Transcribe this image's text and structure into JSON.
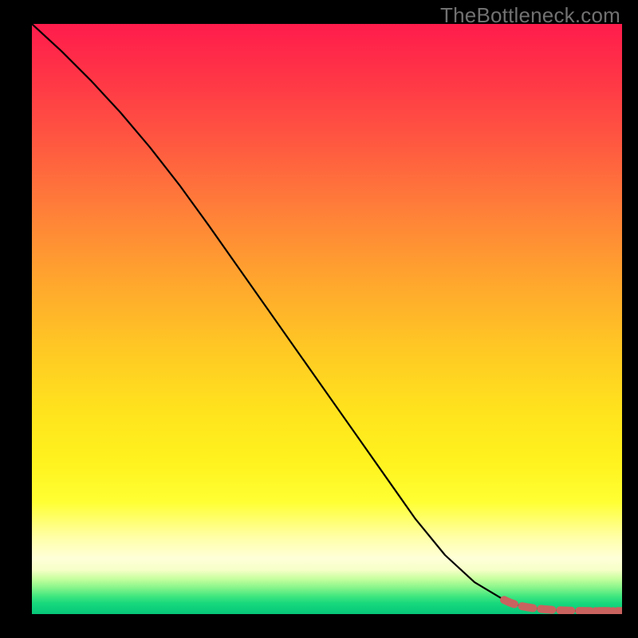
{
  "watermark": "TheBottleneck.com",
  "plot": {
    "x_min": 0,
    "x_max": 100,
    "y_min": 0,
    "y_max": 100
  },
  "chart_data": {
    "type": "line",
    "title": "",
    "xlabel": "",
    "ylabel": "",
    "xlim": [
      0,
      100
    ],
    "ylim": [
      0,
      100
    ],
    "series": [
      {
        "name": "curve",
        "style": "solid-black",
        "x": [
          0,
          5,
          10,
          15,
          20,
          25,
          30,
          35,
          40,
          45,
          50,
          55,
          60,
          65,
          70,
          75,
          80,
          82,
          85,
          88,
          90,
          92,
          94,
          96,
          98,
          100
        ],
        "y": [
          100,
          95.4,
          90.4,
          85.0,
          79.1,
          72.7,
          65.8,
          58.7,
          51.6,
          44.5,
          37.4,
          30.3,
          23.2,
          16.1,
          10.0,
          5.4,
          2.4,
          1.6,
          1.0,
          0.7,
          0.6,
          0.55,
          0.5,
          0.5,
          0.5,
          0.5
        ]
      },
      {
        "name": "highlight-tail",
        "style": "red-dashed-dotted",
        "x": [
          80,
          81,
          82,
          83,
          84,
          85,
          86,
          87,
          88,
          89,
          90,
          91,
          92,
          93,
          94,
          95.5,
          97,
          98.5,
          100
        ],
        "y": [
          2.4,
          1.95,
          1.6,
          1.35,
          1.15,
          1.0,
          0.9,
          0.8,
          0.72,
          0.66,
          0.61,
          0.58,
          0.55,
          0.53,
          0.51,
          0.5,
          0.5,
          0.5,
          0.5
        ]
      }
    ],
    "annotations": []
  },
  "colors": {
    "curve": "#000000",
    "highlight": "#c9635f",
    "watermark": "#717171"
  }
}
